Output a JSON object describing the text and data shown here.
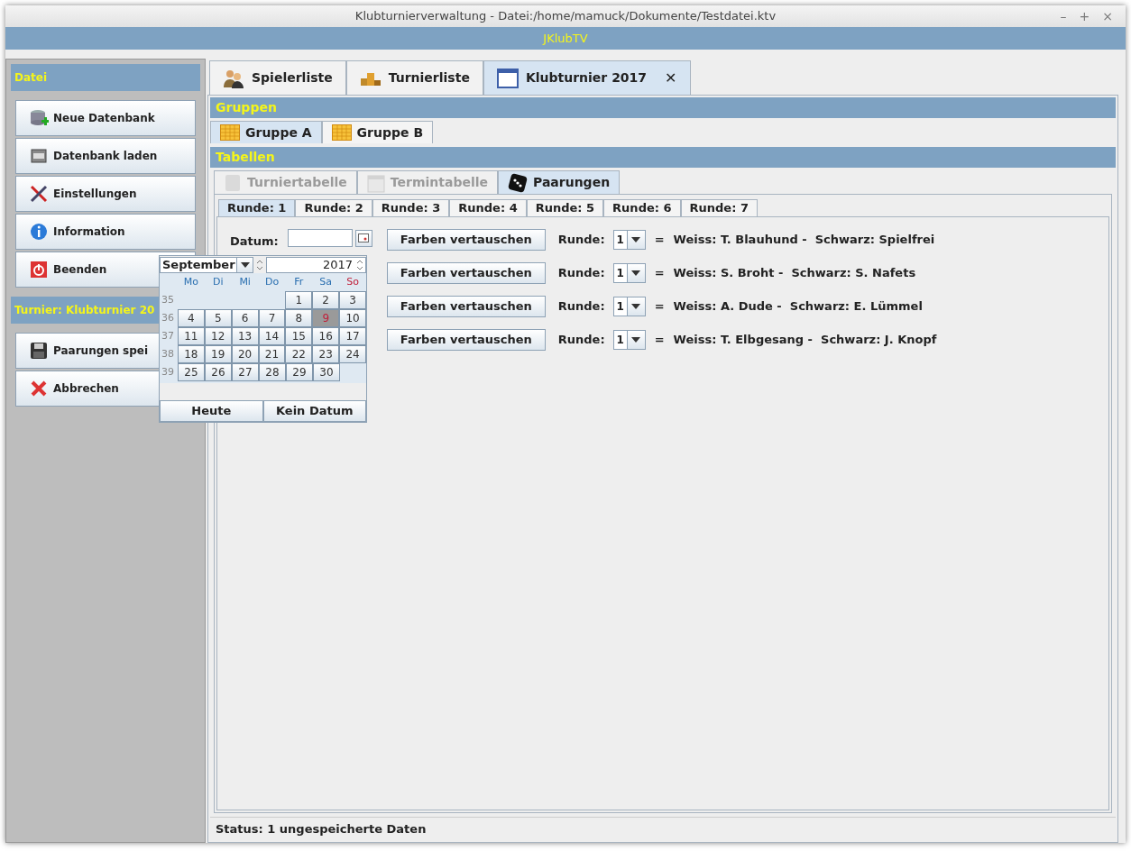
{
  "window": {
    "title": "Klubturnierverwaltung - Datei:/home/mamuck/Dokumente/Testdatei.ktv",
    "controls": [
      "–",
      "+",
      "×"
    ]
  },
  "app_band": "JKlubTV",
  "sidebar": {
    "sections": [
      {
        "title": "Datei",
        "buttons": [
          "Neue Datenbank",
          "Datenbank laden",
          "Einstellungen",
          "Information",
          "Beenden"
        ]
      },
      {
        "title": "Turnier: Klubturnier 20",
        "buttons": [
          "Paarungen spei",
          "Abbrechen"
        ]
      }
    ]
  },
  "main_tabs": [
    {
      "label": "Spielerliste",
      "selected": false,
      "closable": false
    },
    {
      "label": "Turnierliste",
      "selected": false,
      "closable": false
    },
    {
      "label": "Klubturnier 2017",
      "selected": true,
      "closable": true
    }
  ],
  "close_glyph": "✕",
  "groups_header": "Gruppen",
  "group_tabs": [
    {
      "label": "Gruppe A",
      "selected": true
    },
    {
      "label": "Gruppe B",
      "selected": false
    }
  ],
  "tables_header": "Tabellen",
  "table_tabs": [
    {
      "label": "Turniertabelle",
      "selected": false,
      "disabled": true
    },
    {
      "label": "Termintabelle",
      "selected": false,
      "disabled": true
    },
    {
      "label": "Paarungen",
      "selected": true,
      "disabled": false
    }
  ],
  "round_tabs": [
    {
      "label": "Runde: 1",
      "selected": true
    },
    {
      "label": "Runde: 2",
      "selected": false
    },
    {
      "label": "Runde: 3",
      "selected": false
    },
    {
      "label": "Runde: 4",
      "selected": false
    },
    {
      "label": "Runde: 5",
      "selected": false
    },
    {
      "label": "Runde: 6",
      "selected": false
    },
    {
      "label": "Runde: 7",
      "selected": false
    }
  ],
  "date_label": "Datum:",
  "calendar": {
    "month": "September",
    "year": "2017",
    "weekdays": [
      {
        "label": "Mo",
        "color": "#2a6fb0"
      },
      {
        "label": "Di",
        "color": "#2a6fb0"
      },
      {
        "label": "Mi",
        "color": "#2a6fb0"
      },
      {
        "label": "Do",
        "color": "#2a6fb0"
      },
      {
        "label": "Fr",
        "color": "#2a6fb0"
      },
      {
        "label": "Sa",
        "color": "#2a6fb0"
      },
      {
        "label": "So",
        "color": "#c0203a"
      }
    ],
    "weeks": [
      {
        "week": "35",
        "days": [
          {
            "label": "1",
            "selected": false
          },
          {
            "label": "2",
            "selected": false
          },
          {
            "label": "3",
            "selected": false
          }
        ]
      },
      {
        "week": "36",
        "days": [
          {
            "label": "4",
            "selected": false
          },
          {
            "label": "5",
            "selected": false
          },
          {
            "label": "6",
            "selected": false
          },
          {
            "label": "7",
            "selected": false
          },
          {
            "label": "8",
            "selected": false
          },
          {
            "label": "9",
            "selected": true
          },
          {
            "label": "10",
            "selected": false
          }
        ]
      },
      {
        "week": "37",
        "days": [
          {
            "label": "11",
            "selected": false
          },
          {
            "label": "12",
            "selected": false
          },
          {
            "label": "13",
            "selected": false
          },
          {
            "label": "14",
            "selected": false
          },
          {
            "label": "15",
            "selected": false
          },
          {
            "label": "16",
            "selected": false
          },
          {
            "label": "17",
            "selected": false
          }
        ]
      },
      {
        "week": "38",
        "days": [
          {
            "label": "18",
            "selected": false
          },
          {
            "label": "19",
            "selected": false
          },
          {
            "label": "20",
            "selected": false
          },
          {
            "label": "21",
            "selected": false
          },
          {
            "label": "22",
            "selected": false
          },
          {
            "label": "23",
            "selected": false
          },
          {
            "label": "24",
            "selected": false
          }
        ]
      },
      {
        "week": "39",
        "days": [
          {
            "label": "25",
            "selected": false
          },
          {
            "label": "26",
            "selected": false
          },
          {
            "label": "27",
            "selected": false
          },
          {
            "label": "28",
            "selected": false
          },
          {
            "label": "29",
            "selected": false
          },
          {
            "label": "30",
            "selected": false
          }
        ]
      }
    ],
    "buttons": [
      "Heute",
      "Kein Datum"
    ]
  },
  "pairings": [
    {
      "button": "Farben vertauschen",
      "round_label": "Runde:",
      "round": "1",
      "equals": "=",
      "text": "Weiss: T. Blauhund -  Schwarz: Spielfrei"
    },
    {
      "button": "Farben vertauschen",
      "round_label": "Runde:",
      "round": "1",
      "equals": "=",
      "text": "Weiss: S. Broht -  Schwarz: S. Nafets"
    },
    {
      "button": "Farben vertauschen",
      "round_label": "Runde:",
      "round": "1",
      "equals": "=",
      "text": "Weiss: A. Dude -  Schwarz: E. Lümmel"
    },
    {
      "button": "Farben vertauschen",
      "round_label": "Runde:",
      "round": "1",
      "equals": "=",
      "text": "Weiss: T. Elbgesang -  Schwarz: J. Knopf"
    }
  ],
  "status_bar": "Status: 1 ungespeicherte Daten"
}
